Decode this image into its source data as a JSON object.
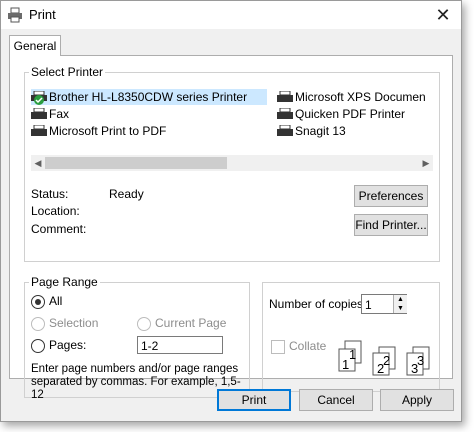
{
  "window": {
    "title": "Print",
    "close_label": "✕"
  },
  "tabs": [
    {
      "label": "General"
    }
  ],
  "select_printer": {
    "label": "Select Printer",
    "printers": [
      {
        "name": "Brother HL-L8350CDW series Printer",
        "selected": true,
        "default": true
      },
      {
        "name": "Fax"
      },
      {
        "name": "Microsoft Print to PDF"
      },
      {
        "name": "Microsoft XPS Documen"
      },
      {
        "name": "Quicken PDF Printer"
      },
      {
        "name": "Snagit 13"
      }
    ],
    "status_label": "Status:",
    "status_value": "Ready",
    "location_label": "Location:",
    "comment_label": "Comment:",
    "preferences_button": "Preferences",
    "find_printer_button": "Find Printer..."
  },
  "page_range": {
    "label": "Page Range",
    "all": "All",
    "selection": "Selection",
    "current_page": "Current Page",
    "pages": "Pages:",
    "pages_value": "1-2",
    "hint": "Enter page numbers and/or page ranges separated by commas.  For example, 1,5-12"
  },
  "copies": {
    "label": "Number of copies:",
    "value": "1",
    "collate": "Collate"
  },
  "footer": {
    "print": "Print",
    "cancel": "Cancel",
    "apply": "Apply"
  },
  "colors": {
    "selection": "#cce8ff",
    "accent": "#0078d7"
  }
}
